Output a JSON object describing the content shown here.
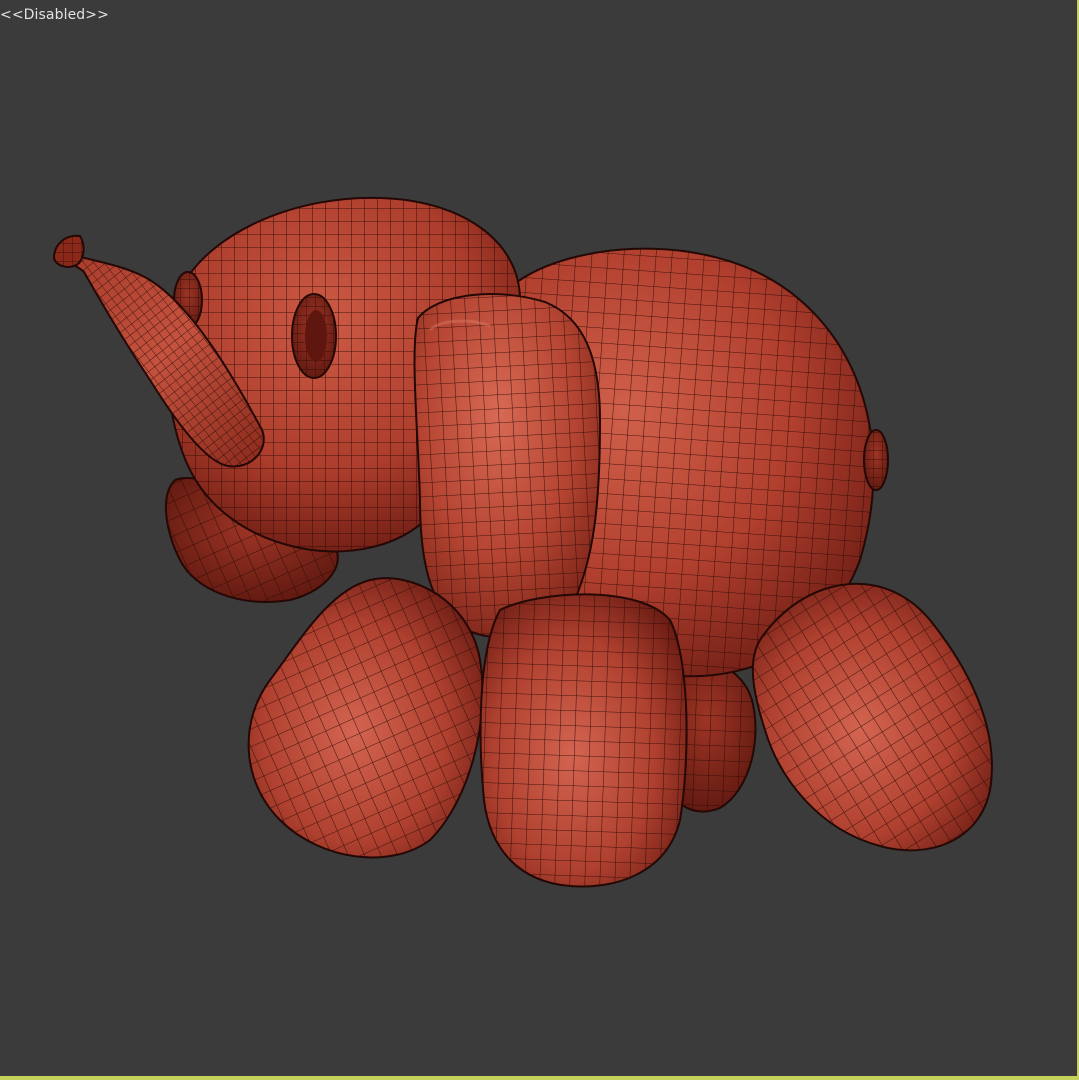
{
  "viewport": {
    "label": "<<Disabled>>",
    "background_color": "#3b3b3b",
    "border_color": "#c6d35a"
  },
  "model": {
    "name": "balloon-elephant",
    "display_mode": "wireframe-on-shaded",
    "surface_color": "#b94936",
    "wire_color": "#2a0a06"
  }
}
